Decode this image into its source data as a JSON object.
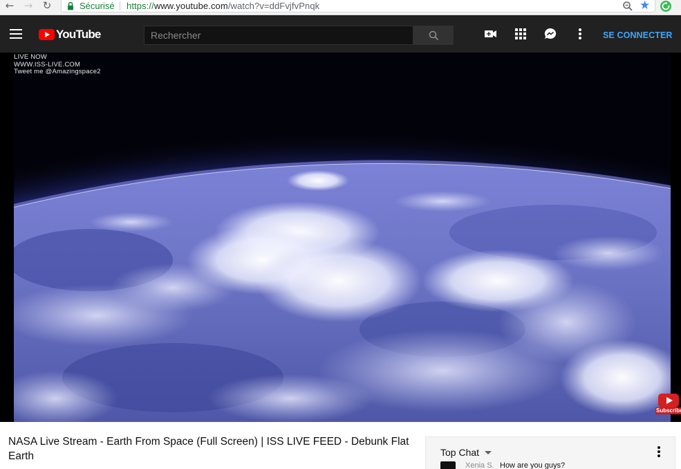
{
  "browser": {
    "secure_label": "Sécurisé",
    "url_scheme": "https://",
    "url_host": "www.youtube.com",
    "url_path": "/watch?v=ddFvjfvPnqk",
    "star_glyph": "★",
    "back_glyph": "←",
    "forward_glyph": "→",
    "reload_glyph": "↻"
  },
  "masthead": {
    "logo_text": "YouTube",
    "search_placeholder": "Rechercher",
    "signin_label": "SE CONNECTER",
    "accent_color": "#3ea6ff",
    "background_color": "#212121"
  },
  "player": {
    "overlay_lines": [
      "LIVE NOW",
      "WWW.ISS-LIVE.COM",
      "Tweet me @Amazingspace2"
    ],
    "subscribe_label": "Subscribe"
  },
  "video": {
    "title": "NASA Live Stream - Earth From Space (Full Screen) | ISS LIVE FEED - Debunk Flat Earth"
  },
  "chat": {
    "header_label": "Top Chat",
    "messages": [
      {
        "author": "Xenia S.",
        "text": "How are you guys?"
      }
    ]
  }
}
